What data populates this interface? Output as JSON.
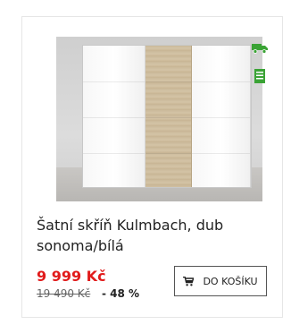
{
  "product": {
    "title": "Šatní skříň Kulmbach, dub sonoma/bílá",
    "price": "9 999 Kč",
    "old_price": "19 490 Kč",
    "discount": "- 48 %",
    "cart_button_label": "DO KOŠÍKU"
  },
  "icons": {
    "delivery": "truck-icon",
    "availability": "document-icon",
    "cart": "cart-icon"
  },
  "colors": {
    "price": "#e11b1b",
    "badge_icons": "#3aa335"
  }
}
